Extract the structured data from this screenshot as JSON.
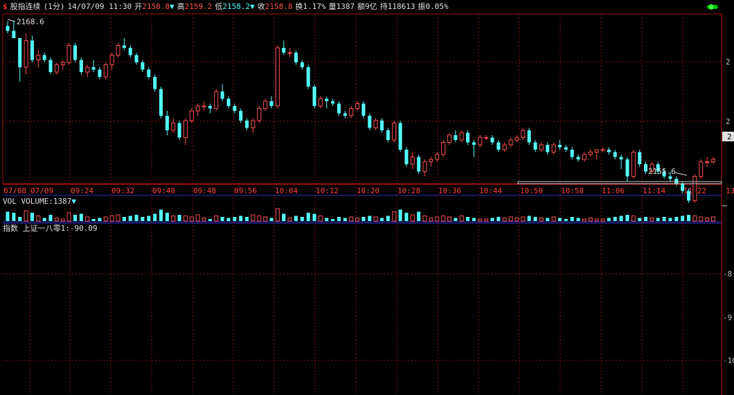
{
  "header": {
    "icon": "dollar-icon",
    "name": "股指连续",
    "period": "(1分)",
    "datetime": "14/07/09 11:30",
    "open_label": "开",
    "open": "2158.8",
    "high_label": "高",
    "high": "2159.2",
    "low_label": "低",
    "low": "2158.2",
    "close_label": "收",
    "close": "2158.8",
    "turnover_label": "换",
    "turnover": "1.17%",
    "volume_label": "量",
    "volume": "1387",
    "amount_label": "额",
    "amount": "9亿",
    "hold_label": "持",
    "hold": "118613",
    "amplitude_label": "振",
    "amplitude": "0.05%"
  },
  "indicator_volume": {
    "label": "VOL VOLUME:1387",
    "arrow": "▼"
  },
  "indicator_index": {
    "label": "指数 上证一八零1:-90.09"
  },
  "annotations": {
    "max": "2168.6",
    "min": "2155.6"
  },
  "right_axis": {
    "price": [
      "2",
      "2",
      "2"
    ],
    "current_price_tag": "2",
    "index": [
      "-8",
      "-9",
      "-10"
    ],
    "time_axis_end": "13"
  },
  "colors": {
    "up": "#ff5050",
    "down": "#54fcfc",
    "grid": "#8a1010",
    "background": "#000000"
  },
  "chart_data": {
    "type": "candlestick",
    "time_labels": [
      "07/08",
      "07/09",
      "09:24",
      "09:32",
      "09:40",
      "09:48",
      "09:56",
      "10:04",
      "10:12",
      "10:20",
      "10:28",
      "10:36",
      "10:44",
      "10:50",
      "10:58",
      "11:06",
      "11:14",
      "11:22"
    ],
    "ylim": [
      2155.0,
      2169.0
    ],
    "index_value": -90.09,
    "index_ylim": [
      -11,
      -7.6
    ],
    "candles": [
      [
        2168.0,
        2168.4,
        2167.4,
        2167.6,
        9
      ],
      [
        2167.6,
        2168.4,
        2167.0,
        2167.0,
        8
      ],
      [
        2167.0,
        2167.0,
        2163.4,
        2164.6,
        4
      ],
      [
        2164.6,
        2167.4,
        2164.0,
        2166.8,
        10
      ],
      [
        2166.8,
        2167.2,
        2165.0,
        2165.2,
        8
      ],
      [
        2165.2,
        2166.0,
        2164.6,
        2165.6,
        5
      ],
      [
        2165.6,
        2165.8,
        2165.0,
        2165.2,
        3
      ],
      [
        2165.2,
        2165.4,
        2164.0,
        2164.2,
        6
      ],
      [
        2164.2,
        2165.0,
        2164.0,
        2164.8,
        3
      ],
      [
        2164.8,
        2165.2,
        2164.4,
        2165.0,
        2
      ],
      [
        2165.0,
        2166.6,
        2164.8,
        2166.4,
        8
      ],
      [
        2166.4,
        2166.6,
        2165.0,
        2165.2,
        6
      ],
      [
        2165.2,
        2165.4,
        2164.0,
        2164.2,
        7
      ],
      [
        2164.2,
        2164.8,
        2163.8,
        2164.6,
        4
      ],
      [
        2164.6,
        2165.2,
        2164.2,
        2164.4,
        2
      ],
      [
        2164.4,
        2164.6,
        2163.6,
        2163.8,
        3
      ],
      [
        2163.8,
        2165.0,
        2163.6,
        2164.8,
        4
      ],
      [
        2164.8,
        2165.8,
        2164.4,
        2165.6,
        5
      ],
      [
        2165.6,
        2166.6,
        2165.4,
        2166.4,
        6
      ],
      [
        2166.4,
        2167.0,
        2166.0,
        2166.2,
        4
      ],
      [
        2166.2,
        2166.4,
        2165.4,
        2165.6,
        5
      ],
      [
        2165.6,
        2165.8,
        2164.8,
        2165.0,
        6
      ],
      [
        2165.0,
        2165.2,
        2164.2,
        2164.4,
        4
      ],
      [
        2164.4,
        2164.6,
        2163.6,
        2163.8,
        5
      ],
      [
        2163.8,
        2164.0,
        2162.6,
        2162.8,
        7
      ],
      [
        2162.8,
        2163.0,
        2160.4,
        2160.6,
        11
      ],
      [
        2160.6,
        2161.0,
        2159.0,
        2159.4,
        8
      ],
      [
        2159.4,
        2160.4,
        2159.2,
        2160.0,
        5
      ],
      [
        2160.0,
        2160.2,
        2158.6,
        2158.8,
        6
      ],
      [
        2158.8,
        2160.4,
        2158.2,
        2160.2,
        5
      ],
      [
        2160.2,
        2161.2,
        2160.0,
        2161.0,
        4
      ],
      [
        2161.0,
        2161.6,
        2160.6,
        2161.4,
        6
      ],
      [
        2161.4,
        2161.8,
        2161.0,
        2161.4,
        3
      ],
      [
        2161.4,
        2161.6,
        2160.8,
        2161.2,
        2
      ],
      [
        2161.2,
        2162.8,
        2161.0,
        2162.6,
        5
      ],
      [
        2162.6,
        2163.2,
        2161.8,
        2162.0,
        4
      ],
      [
        2162.0,
        2162.2,
        2161.2,
        2161.4,
        3
      ],
      [
        2161.4,
        2161.6,
        2160.8,
        2161.0,
        4
      ],
      [
        2161.0,
        2161.2,
        2160.0,
        2160.2,
        5
      ],
      [
        2160.2,
        2160.4,
        2159.4,
        2159.6,
        4
      ],
      [
        2159.6,
        2160.4,
        2159.2,
        2160.2,
        6
      ],
      [
        2160.2,
        2161.4,
        2160.0,
        2161.2,
        5
      ],
      [
        2161.2,
        2162.0,
        2161.0,
        2161.8,
        4
      ],
      [
        2161.8,
        2162.2,
        2161.2,
        2161.4,
        3
      ],
      [
        2161.4,
        2166.4,
        2161.2,
        2166.2,
        12
      ],
      [
        2166.2,
        2166.8,
        2165.6,
        2165.8,
        7
      ],
      [
        2165.8,
        2166.2,
        2165.4,
        2165.8,
        3
      ],
      [
        2165.8,
        2166.0,
        2164.8,
        2165.0,
        5
      ],
      [
        2165.0,
        2165.2,
        2164.4,
        2164.6,
        4
      ],
      [
        2164.6,
        2164.8,
        2162.8,
        2163.0,
        8
      ],
      [
        2163.0,
        2163.2,
        2161.2,
        2161.4,
        7
      ],
      [
        2161.4,
        2162.2,
        2161.2,
        2162.0,
        5
      ],
      [
        2162.0,
        2162.2,
        2161.2,
        2161.8,
        3
      ],
      [
        2161.8,
        2162.0,
        2161.4,
        2161.6,
        2
      ],
      [
        2161.6,
        2161.8,
        2160.6,
        2160.8,
        4
      ],
      [
        2160.8,
        2161.0,
        2160.4,
        2160.6,
        3
      ],
      [
        2160.6,
        2161.4,
        2160.4,
        2161.2,
        4
      ],
      [
        2161.2,
        2161.8,
        2161.0,
        2161.6,
        3
      ],
      [
        2161.6,
        2161.8,
        2160.4,
        2160.6,
        4
      ],
      [
        2160.6,
        2160.8,
        2159.4,
        2159.6,
        5
      ],
      [
        2159.6,
        2160.4,
        2159.4,
        2160.2,
        4
      ],
      [
        2160.2,
        2160.4,
        2159.2,
        2159.4,
        3
      ],
      [
        2159.4,
        2159.6,
        2158.4,
        2158.6,
        5
      ],
      [
        2158.6,
        2160.2,
        2158.4,
        2160.0,
        9
      ],
      [
        2160.0,
        2160.2,
        2157.6,
        2157.8,
        11
      ],
      [
        2157.8,
        2158.0,
        2156.4,
        2156.6,
        8
      ],
      [
        2156.6,
        2157.6,
        2156.2,
        2157.2,
        6
      ],
      [
        2157.2,
        2157.4,
        2155.8,
        2156.0,
        9
      ],
      [
        2156.0,
        2157.0,
        2155.6,
        2156.8,
        5
      ],
      [
        2156.8,
        2157.2,
        2156.4,
        2157.0,
        3
      ],
      [
        2157.0,
        2157.6,
        2156.8,
        2157.4,
        4
      ],
      [
        2157.4,
        2158.6,
        2157.2,
        2158.4,
        5
      ],
      [
        2158.4,
        2159.2,
        2158.2,
        2159.0,
        4
      ],
      [
        2159.0,
        2159.4,
        2158.4,
        2158.6,
        3
      ],
      [
        2158.6,
        2159.4,
        2158.4,
        2159.2,
        5
      ],
      [
        2159.2,
        2159.4,
        2158.2,
        2158.4,
        4
      ],
      [
        2158.4,
        2158.6,
        2157.2,
        2158.2,
        3
      ],
      [
        2158.2,
        2159.0,
        2158.0,
        2158.8,
        2
      ],
      [
        2158.8,
        2159.0,
        2158.6,
        2158.8,
        2
      ],
      [
        2158.8,
        2159.0,
        2158.2,
        2158.4,
        3
      ],
      [
        2158.4,
        2158.6,
        2157.6,
        2157.8,
        4
      ],
      [
        2157.8,
        2158.4,
        2157.6,
        2158.2,
        3
      ],
      [
        2158.2,
        2158.8,
        2158.0,
        2158.6,
        4
      ],
      [
        2158.6,
        2159.0,
        2158.4,
        2158.8,
        3
      ],
      [
        2158.8,
        2159.6,
        2158.6,
        2159.4,
        4
      ],
      [
        2159.4,
        2159.6,
        2158.2,
        2158.4,
        5
      ],
      [
        2158.4,
        2158.6,
        2157.6,
        2157.8,
        4
      ],
      [
        2157.8,
        2158.4,
        2157.6,
        2158.2,
        3
      ],
      [
        2158.2,
        2158.4,
        2157.4,
        2157.6,
        3
      ],
      [
        2157.6,
        2158.4,
        2157.4,
        2158.2,
        4
      ],
      [
        2158.2,
        2158.6,
        2157.8,
        2158.0,
        3
      ],
      [
        2158.0,
        2158.2,
        2157.6,
        2157.8,
        2
      ],
      [
        2157.8,
        2158.0,
        2157.0,
        2157.2,
        4
      ],
      [
        2157.2,
        2157.4,
        2156.8,
        2157.0,
        3
      ],
      [
        2157.0,
        2157.6,
        2156.8,
        2157.4,
        2
      ],
      [
        2157.4,
        2157.8,
        2157.2,
        2157.6,
        3
      ],
      [
        2157.6,
        2157.8,
        2157.0,
        2157.8,
        2
      ],
      [
        2157.8,
        2158.0,
        2157.6,
        2157.8,
        2
      ],
      [
        2157.8,
        2158.0,
        2157.4,
        2157.6,
        3
      ],
      [
        2157.6,
        2157.8,
        2157.0,
        2157.2,
        4
      ],
      [
        2157.2,
        2157.4,
        2156.2,
        2157.0,
        5
      ],
      [
        2157.0,
        2157.2,
        2155.2,
        2155.6,
        6
      ],
      [
        2155.6,
        2157.8,
        2155.4,
        2157.6,
        5
      ],
      [
        2157.6,
        2157.8,
        2156.4,
        2156.6,
        3
      ],
      [
        2156.6,
        2156.8,
        2155.8,
        2156.0,
        4
      ],
      [
        2156.0,
        2156.8,
        2155.8,
        2156.6,
        3
      ],
      [
        2156.6,
        2156.8,
        2155.8,
        2156.0,
        3
      ],
      [
        2156.0,
        2156.2,
        2155.4,
        2155.6,
        4
      ],
      [
        2155.6,
        2156.0,
        2155.2,
        2155.4,
        3
      ],
      [
        2155.4,
        2155.6,
        2154.8,
        2155.0,
        4
      ],
      [
        2155.0,
        2155.2,
        2154.2,
        2154.4,
        5
      ],
      [
        2154.4,
        2154.6,
        2153.4,
        2153.6,
        6
      ],
      [
        2153.6,
        2155.8,
        2153.4,
        2155.6,
        5
      ],
      [
        2155.6,
        2157.0,
        2155.4,
        2156.8,
        4
      ],
      [
        2156.8,
        2157.2,
        2156.4,
        2156.8,
        3
      ],
      [
        2156.8,
        2157.2,
        2156.6,
        2157.0,
        4
      ]
    ]
  }
}
